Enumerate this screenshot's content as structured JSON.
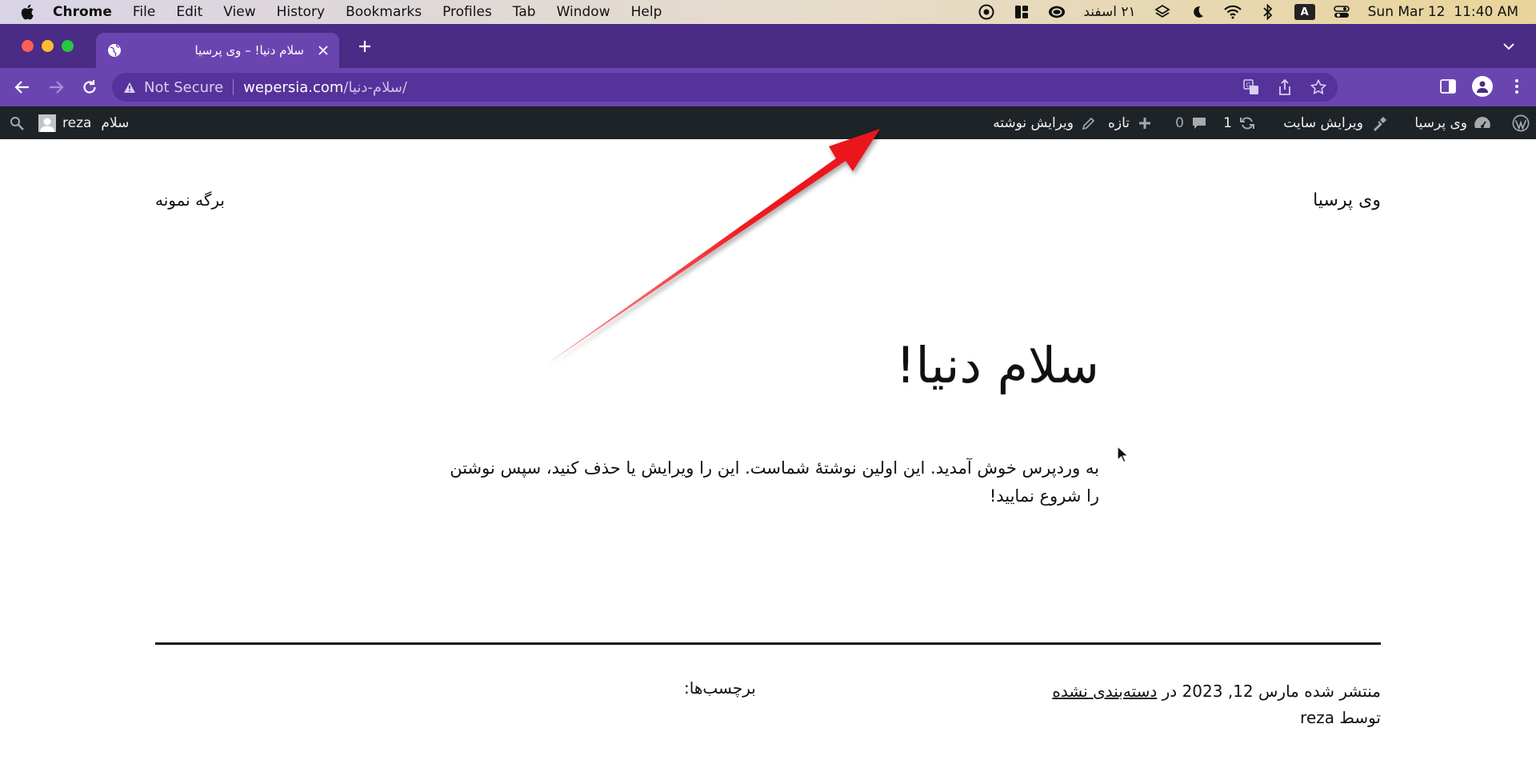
{
  "menubar": {
    "app_name": "Chrome",
    "items": [
      "File",
      "Edit",
      "View",
      "History",
      "Bookmarks",
      "Profiles",
      "Tab",
      "Window",
      "Help"
    ],
    "persian_date": "۲۱ اسفند",
    "input_source": "A",
    "datetime": "Sun Mar 12  11:40 AM"
  },
  "tab": {
    "title": "سلام دنیا! – وی پرسیا"
  },
  "omnibox": {
    "security_label": "Not Secure",
    "url_host": "wepersia.com",
    "url_path": "/سلام-دنیا/"
  },
  "adminbar": {
    "site_name": "وی پرسیا",
    "edit_site": "ویرایش سایت",
    "updates_count": "1",
    "comments_count": "0",
    "new_label": "تازه",
    "edit_post": "ویرایش نوشته",
    "greeting": "سلام",
    "username": "reza"
  },
  "site": {
    "title": "وی پرسیا",
    "nav_item": "برگه نمونه"
  },
  "post": {
    "title": "سلام دنیا!",
    "body": "به وردپرس خوش آمدید. این اولین نوشتهٔ شماست. این را ویرایش یا حذف کنید، سپس نوشتن را شروع نمایید!",
    "meta_prefix": "منتشر شده مارس 12, 2023 در",
    "category": "دسته‌بندی نشده",
    "author_line": "توسط reza",
    "tags_label": "برچسب‌ها:"
  },
  "colors": {
    "tabstrip": "#4a2b86",
    "toolbar": "#6a45b0",
    "adminbar": "#1d2327",
    "annotation_arrow": "#e8141a"
  }
}
